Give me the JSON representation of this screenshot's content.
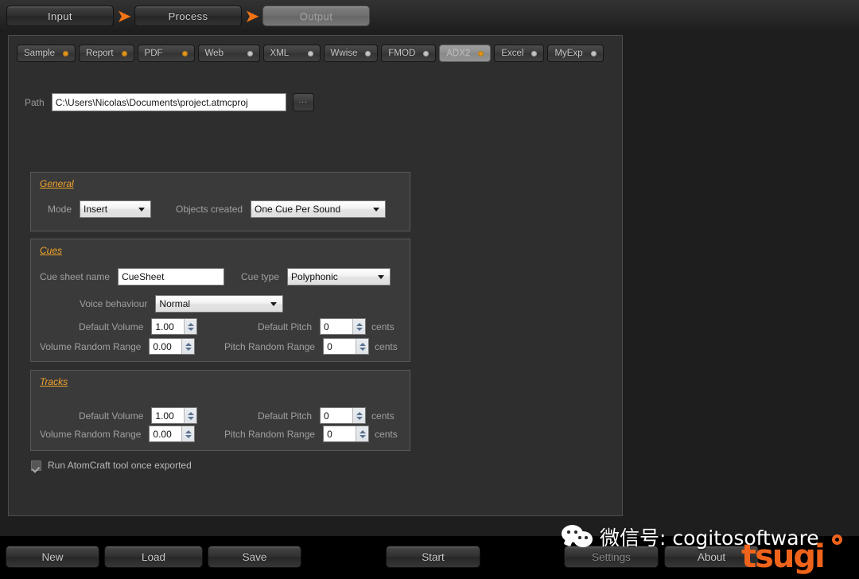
{
  "wizard": {
    "steps": [
      {
        "label": "Input",
        "state": "normal"
      },
      {
        "label": "Process",
        "state": "normal"
      },
      {
        "label": "Output",
        "state": "disabled"
      }
    ],
    "arrow_icon": "chevron-right-icon",
    "arrow_color": "#f07315"
  },
  "tabs": [
    {
      "label": "Sample",
      "led": "#f5a31e",
      "active": false
    },
    {
      "label": "Report",
      "led": "#f5a31e",
      "active": false
    },
    {
      "label": "PDF",
      "led": "#f5a31e",
      "active": false
    },
    {
      "label": "Web",
      "led": "#d8d8d8",
      "active": false
    },
    {
      "label": "XML",
      "led": "#d8d8d8",
      "active": false
    },
    {
      "label": "Wwise",
      "led": "#d8d8d8",
      "active": false
    },
    {
      "label": "FMOD",
      "led": "#d8d8d8",
      "active": false
    },
    {
      "label": "ADX2",
      "led": "#f5a31e",
      "active": true
    },
    {
      "label": "Excel",
      "led": "#d8d8d8",
      "active": false
    },
    {
      "label": "MyExp",
      "led": "#d8d8d8",
      "active": false
    }
  ],
  "path": {
    "label": "Path",
    "value": "C:\\Users\\Nicolas\\Documents\\project.atmcproj",
    "placeholder": "",
    "browse_label": "..."
  },
  "general": {
    "title": "General",
    "mode_label": "Mode",
    "mode_value": "Insert",
    "objects_label": "Objects created",
    "objects_value": "One Cue Per Sound"
  },
  "cues": {
    "title": "Cues",
    "cue_sheet_name_label": "Cue sheet name",
    "cue_sheet_name_value": "CueSheet",
    "cue_type_label": "Cue type",
    "cue_type_value": "Polyphonic",
    "voice_behaviour_label": "Voice behaviour",
    "voice_behaviour_value": "Normal",
    "default_volume_label": "Default Volume",
    "default_volume_value": "1.00",
    "volume_random_label": "Volume Random Range",
    "volume_random_value": "0.00",
    "default_pitch_label": "Default Pitch",
    "default_pitch_value": "0",
    "default_pitch_unit": "cents",
    "pitch_random_label": "Pitch Random Range",
    "pitch_random_value": "0",
    "pitch_random_unit": "cents"
  },
  "tracks": {
    "title": "Tracks",
    "default_volume_label": "Default Volume",
    "default_volume_value": "1.00",
    "volume_random_label": "Volume Random Range",
    "volume_random_value": "0.00",
    "default_pitch_label": "Default Pitch",
    "default_pitch_value": "0",
    "default_pitch_unit": "cents",
    "pitch_random_label": "Pitch Random Range",
    "pitch_random_value": "0",
    "pitch_random_unit": "cents"
  },
  "run_tool": {
    "label": "Run AtomCraft tool once exported",
    "checked": true
  },
  "bottom_bar": {
    "new_label": "New",
    "load_label": "Load",
    "save_label": "Save",
    "start_label": "Start",
    "settings_label": "Settings",
    "about_label": "About"
  },
  "watermark": {
    "icon": "wechat-icon",
    "text": "微信号: cogitosoftware",
    "logo_text": "tsugi",
    "logo_color": "#f0631b"
  }
}
